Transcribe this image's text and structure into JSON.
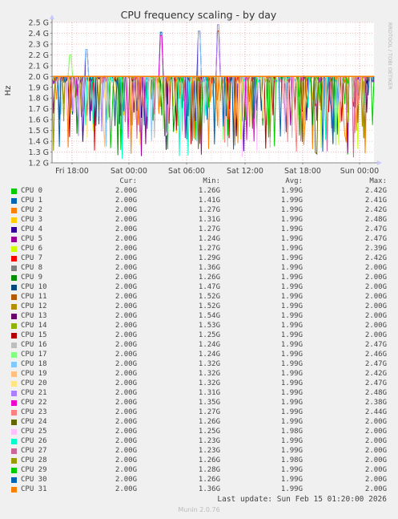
{
  "chart_data": {
    "type": "line",
    "title": "CPU frequency scaling - by day",
    "ylabel": "Hz",
    "watermark": "RRDTOOL / TOBI OETIKER",
    "ylim": [
      1.2,
      2.5
    ],
    "y_ticks": [
      "1.2 G",
      "1.3 G",
      "1.4 G",
      "1.5 G",
      "1.6 G",
      "1.7 G",
      "1.8 G",
      "1.9 G",
      "2.0 G",
      "2.1 G",
      "2.2 G",
      "2.3 G",
      "2.4 G",
      "2.5 G"
    ],
    "x_ticks": [
      "Fri 18:00",
      "Sat 00:00",
      "Sat 06:00",
      "Sat 12:00",
      "Sat 18:00",
      "Sun 00:00"
    ],
    "grid": true,
    "baseline": 2.0,
    "series": [
      {
        "name": "CPU 0",
        "color": "#00cc00",
        "cur": "2.00G",
        "min": "1.26G",
        "avg": "1.99G",
        "max": "2.42G"
      },
      {
        "name": "CPU 1",
        "color": "#0066b3",
        "cur": "2.00G",
        "min": "1.41G",
        "avg": "1.99G",
        "max": "2.41G"
      },
      {
        "name": "CPU 2",
        "color": "#ff8000",
        "cur": "2.00G",
        "min": "1.27G",
        "avg": "1.99G",
        "max": "2.42G"
      },
      {
        "name": "CPU 3",
        "color": "#ffcc00",
        "cur": "2.00G",
        "min": "1.31G",
        "avg": "1.99G",
        "max": "2.48G"
      },
      {
        "name": "CPU 4",
        "color": "#330099",
        "cur": "2.00G",
        "min": "1.27G",
        "avg": "1.99G",
        "max": "2.47G"
      },
      {
        "name": "CPU 5",
        "color": "#990099",
        "cur": "2.00G",
        "min": "1.24G",
        "avg": "1.99G",
        "max": "2.47G"
      },
      {
        "name": "CPU 6",
        "color": "#ccff00",
        "cur": "2.00G",
        "min": "1.27G",
        "avg": "1.99G",
        "max": "2.39G"
      },
      {
        "name": "CPU 7",
        "color": "#ff0000",
        "cur": "2.00G",
        "min": "1.29G",
        "avg": "1.99G",
        "max": "2.42G"
      },
      {
        "name": "CPU 8",
        "color": "#808080",
        "cur": "2.00G",
        "min": "1.36G",
        "avg": "1.99G",
        "max": "2.00G"
      },
      {
        "name": "CPU 9",
        "color": "#008f00",
        "cur": "2.00G",
        "min": "1.26G",
        "avg": "1.99G",
        "max": "2.00G"
      },
      {
        "name": "CPU 10",
        "color": "#00487d",
        "cur": "2.00G",
        "min": "1.47G",
        "avg": "1.99G",
        "max": "2.00G"
      },
      {
        "name": "CPU 11",
        "color": "#b35a00",
        "cur": "2.00G",
        "min": "1.52G",
        "avg": "1.99G",
        "max": "2.00G"
      },
      {
        "name": "CPU 12",
        "color": "#b38f00",
        "cur": "2.00G",
        "min": "1.52G",
        "avg": "1.99G",
        "max": "2.00G"
      },
      {
        "name": "CPU 13",
        "color": "#6b006b",
        "cur": "2.00G",
        "min": "1.54G",
        "avg": "1.99G",
        "max": "2.00G"
      },
      {
        "name": "CPU 14",
        "color": "#8fb300",
        "cur": "2.00G",
        "min": "1.53G",
        "avg": "1.99G",
        "max": "2.00G"
      },
      {
        "name": "CPU 15",
        "color": "#b30000",
        "cur": "2.00G",
        "min": "1.25G",
        "avg": "1.99G",
        "max": "2.00G"
      },
      {
        "name": "CPU 16",
        "color": "#bebebe",
        "cur": "2.00G",
        "min": "1.24G",
        "avg": "1.99G",
        "max": "2.47G"
      },
      {
        "name": "CPU 17",
        "color": "#80ff80",
        "cur": "2.00G",
        "min": "1.24G",
        "avg": "1.99G",
        "max": "2.46G"
      },
      {
        "name": "CPU 18",
        "color": "#80c9ff",
        "cur": "2.00G",
        "min": "1.32G",
        "avg": "1.99G",
        "max": "2.47G"
      },
      {
        "name": "CPU 19",
        "color": "#ffc080",
        "cur": "2.00G",
        "min": "1.32G",
        "avg": "1.99G",
        "max": "2.42G"
      },
      {
        "name": "CPU 20",
        "color": "#ffe680",
        "cur": "2.00G",
        "min": "1.32G",
        "avg": "1.99G",
        "max": "2.47G"
      },
      {
        "name": "CPU 21",
        "color": "#aa80ff",
        "cur": "2.00G",
        "min": "1.31G",
        "avg": "1.99G",
        "max": "2.48G"
      },
      {
        "name": "CPU 22",
        "color": "#ee00cc",
        "cur": "2.00G",
        "min": "1.35G",
        "avg": "1.99G",
        "max": "2.38G"
      },
      {
        "name": "CPU 23",
        "color": "#ff8080",
        "cur": "2.00G",
        "min": "1.27G",
        "avg": "1.99G",
        "max": "2.44G"
      },
      {
        "name": "CPU 24",
        "color": "#666600",
        "cur": "2.00G",
        "min": "1.26G",
        "avg": "1.99G",
        "max": "2.00G"
      },
      {
        "name": "CPU 25",
        "color": "#ffbfff",
        "cur": "2.00G",
        "min": "1.25G",
        "avg": "1.98G",
        "max": "2.00G"
      },
      {
        "name": "CPU 26",
        "color": "#00ffcc",
        "cur": "2.00G",
        "min": "1.23G",
        "avg": "1.99G",
        "max": "2.00G"
      },
      {
        "name": "CPU 27",
        "color": "#cc6699",
        "cur": "2.00G",
        "min": "1.23G",
        "avg": "1.99G",
        "max": "2.00G"
      },
      {
        "name": "CPU 28",
        "color": "#999900",
        "cur": "2.00G",
        "min": "1.26G",
        "avg": "1.98G",
        "max": "2.00G"
      },
      {
        "name": "CPU 29",
        "color": "#00cc00",
        "cur": "2.00G",
        "min": "1.28G",
        "avg": "1.99G",
        "max": "2.00G"
      },
      {
        "name": "CPU 30",
        "color": "#0066b3",
        "cur": "2.00G",
        "min": "1.26G",
        "avg": "1.99G",
        "max": "2.00G"
      },
      {
        "name": "CPU 31",
        "color": "#ff8000",
        "cur": "2.00G",
        "min": "1.36G",
        "avg": "1.99G",
        "max": "2.00G"
      }
    ]
  },
  "legend_headers": {
    "cur": "Cur:",
    "min": "Min:",
    "avg": "Avg:",
    "max": "Max:"
  },
  "footer": {
    "last_update": "Last update: Sun Feb 15 01:20:00 2026",
    "munin_version": "Munin 2.0.76"
  }
}
